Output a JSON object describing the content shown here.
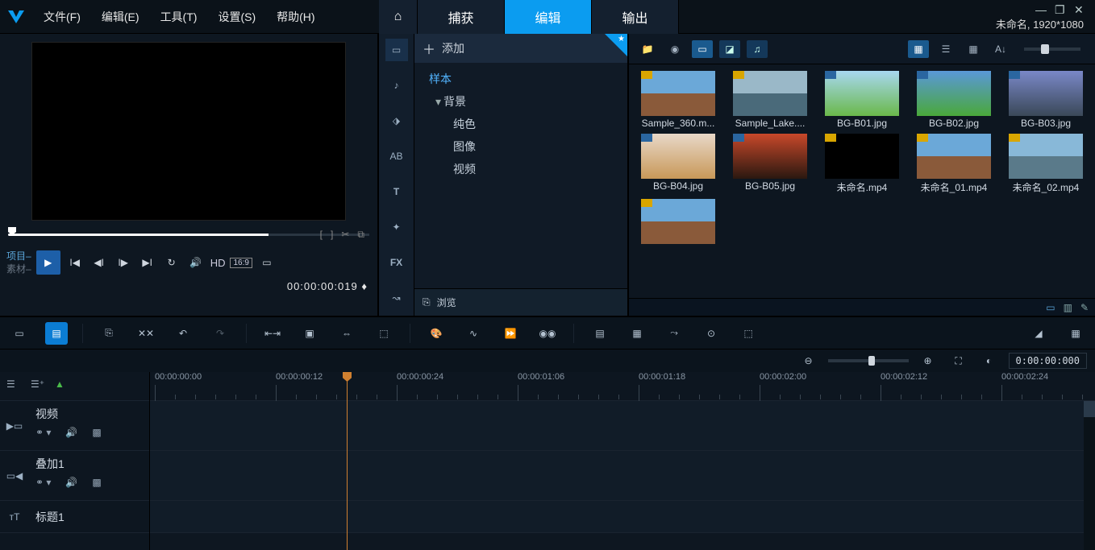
{
  "menu": {
    "file": "文件(F)",
    "edit": "编辑(E)",
    "tools": "工具(T)",
    "settings": "设置(S)",
    "help": "帮助(H)"
  },
  "modeTabs": {
    "capture": "捕获",
    "edit": "编辑",
    "output": "输出"
  },
  "projectInfo": "未命名, 1920*1080",
  "preview": {
    "projectLabel": "项目",
    "clipLabel": "素材",
    "hd": "HD",
    "aspect": "16:9",
    "timecode": "00:00:00:019",
    "timecodeSuffix": " ♦"
  },
  "library": {
    "addLabel": "添加",
    "browseLabel": "浏览",
    "tree": {
      "sample": "样本",
      "background": "背景",
      "solid": "纯色",
      "image": "图像",
      "video": "视频"
    },
    "items": [
      {
        "name": "Sample_360.m...",
        "bg": "bg-sample360",
        "badge": "vid"
      },
      {
        "name": "Sample_Lake....",
        "bg": "bg-lake",
        "badge": "vid"
      },
      {
        "name": "BG-B01.jpg",
        "bg": "bg-b01",
        "badge": "img"
      },
      {
        "name": "BG-B02.jpg",
        "bg": "bg-b02",
        "badge": "img"
      },
      {
        "name": "BG-B03.jpg",
        "bg": "bg-b03",
        "badge": "img"
      },
      {
        "name": "BG-B04.jpg",
        "bg": "bg-b04",
        "badge": "img"
      },
      {
        "name": "BG-B05.jpg",
        "bg": "bg-b05",
        "badge": "img"
      },
      {
        "name": "未命名.mp4",
        "bg": "bg-black",
        "badge": "vid"
      },
      {
        "name": "未命名_01.mp4",
        "bg": "bg-u01",
        "badge": "vid"
      },
      {
        "name": "未命名_02.mp4",
        "bg": "bg-u02",
        "badge": "vid"
      },
      {
        "name": "",
        "bg": "bg-sample360",
        "badge": "vid"
      }
    ]
  },
  "timeline": {
    "ticks": [
      {
        "label": "00:00:00:00",
        "pos": 0
      },
      {
        "label": "00:00:00:12",
        "pos": 150
      },
      {
        "label": "00:00:00:24",
        "pos": 300
      },
      {
        "label": "00:00:01:06",
        "pos": 450
      },
      {
        "label": "00:00:01:18",
        "pos": 600
      },
      {
        "label": "00:00:02:00",
        "pos": 750
      },
      {
        "label": "00:00:02:12",
        "pos": 900
      },
      {
        "label": "00:00:02:24",
        "pos": 1050
      }
    ],
    "tracks": {
      "video": "视频",
      "overlay": "叠加1",
      "title": "标题1"
    },
    "zoomTimecode": "0:00:00:000"
  }
}
